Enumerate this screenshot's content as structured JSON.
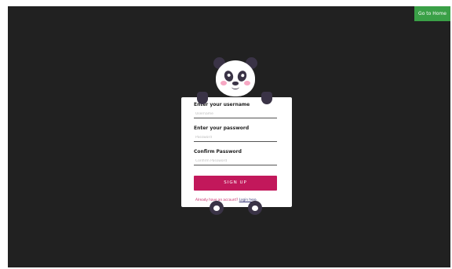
{
  "header": {
    "home_button_label": "Go to Home"
  },
  "form": {
    "username_label": "Enter your username",
    "username_placeholder": "Username",
    "password_label": "Enter your password",
    "password_placeholder": "Password",
    "confirm_label": "Confirm Password",
    "confirm_placeholder": "Confirm Password",
    "signup_label": "SIGN UP",
    "footer_text": "Already have an account?",
    "login_link": "Login here"
  },
  "colors": {
    "background": "#212121",
    "accent": "#c2185b",
    "home_button": "#3aa047",
    "panda_dark": "#3a3346"
  },
  "icons": [
    "panda-head-icon",
    "panda-paw-icon"
  ]
}
